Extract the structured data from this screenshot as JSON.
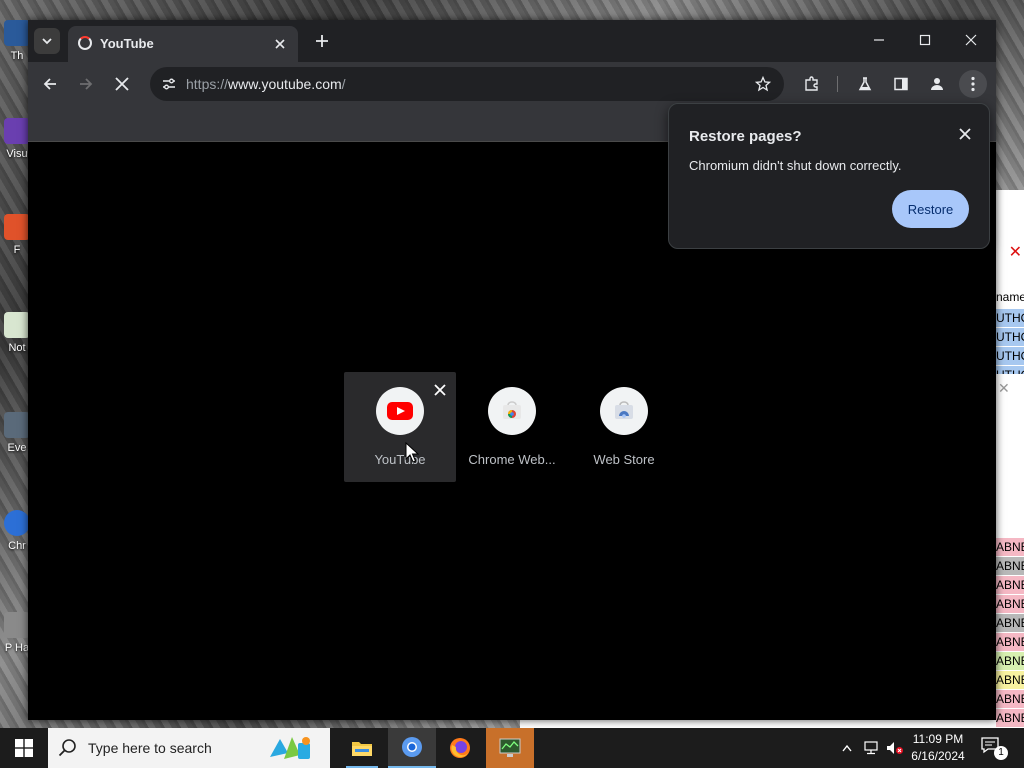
{
  "desktop": {
    "icons": [
      {
        "label": "Th",
        "name": "desktop-icon-th"
      },
      {
        "label": "Visu",
        "name": "desktop-icon-visual-studio"
      },
      {
        "label": "F",
        "name": "desktop-icon-f"
      },
      {
        "label": "Not",
        "name": "desktop-icon-notepad"
      },
      {
        "label": "Eve",
        "name": "desktop-icon-event"
      },
      {
        "label": "Chr",
        "name": "desktop-icon-chrome"
      },
      {
        "label": "P Ha",
        "name": "desktop-icon-p-ha"
      }
    ]
  },
  "background_window": {
    "column_header": "name",
    "rows": [
      "UTHO",
      "UTHO",
      "UTHO",
      "UTHO",
      "ABNE",
      "ABNE",
      "ABNE",
      "ABNE",
      "ABNE",
      "ABNE",
      "ABNE",
      "ABNE",
      "ABNE",
      "ABNE"
    ]
  },
  "browser": {
    "tab": {
      "title": "YouTube"
    },
    "url": {
      "prefix": "https://",
      "host": "www.youtube.com",
      "path": "/"
    },
    "shortcuts": [
      {
        "name": "YouTube"
      },
      {
        "name": "Chrome Web..."
      },
      {
        "name": "Web Store"
      }
    ],
    "restore_bubble": {
      "heading": "Restore pages?",
      "message": "Chromium didn't shut down correctly.",
      "button": "Restore"
    }
  },
  "taskbar": {
    "search_placeholder": "Type here to search",
    "clock_time": "11:09 PM",
    "clock_date": "6/16/2024",
    "notification_count": "1"
  },
  "colors": {
    "accent_blue": "#a8c7fa",
    "youtube_red": "#ff0000",
    "taskbar_highlight": "#c8702a"
  }
}
